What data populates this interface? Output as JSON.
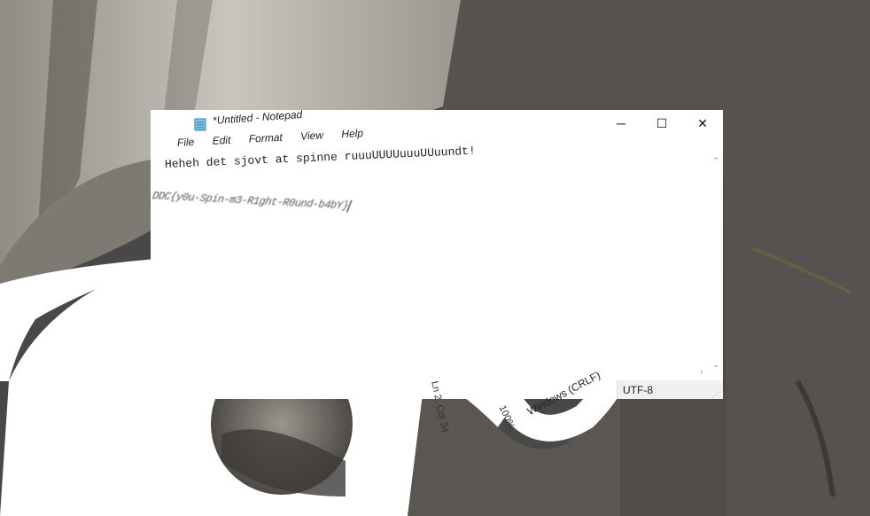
{
  "window": {
    "title": "*Untitled - Notepad",
    "icon": "notepad-icon",
    "controls": {
      "minimize": "─",
      "maximize": "☐",
      "close": "✕"
    }
  },
  "menubar": {
    "items": [
      "File",
      "Edit",
      "Format",
      "View",
      "Help"
    ]
  },
  "editor": {
    "line1": "Heheh det sjovt at spinne ruuuUUUUuuuUUuundt!",
    "line2": "DDC{y0u-Spin-m3-R1ght-R0und-b4bY}"
  },
  "statusbar": {
    "encoding": "UTF-8",
    "line_ending": "Windows (CRLF)",
    "zoom": "100%",
    "position": "Ln 2, Col 34"
  },
  "scroll": {
    "up": "⌃",
    "down": "⌄",
    "right": "›"
  }
}
